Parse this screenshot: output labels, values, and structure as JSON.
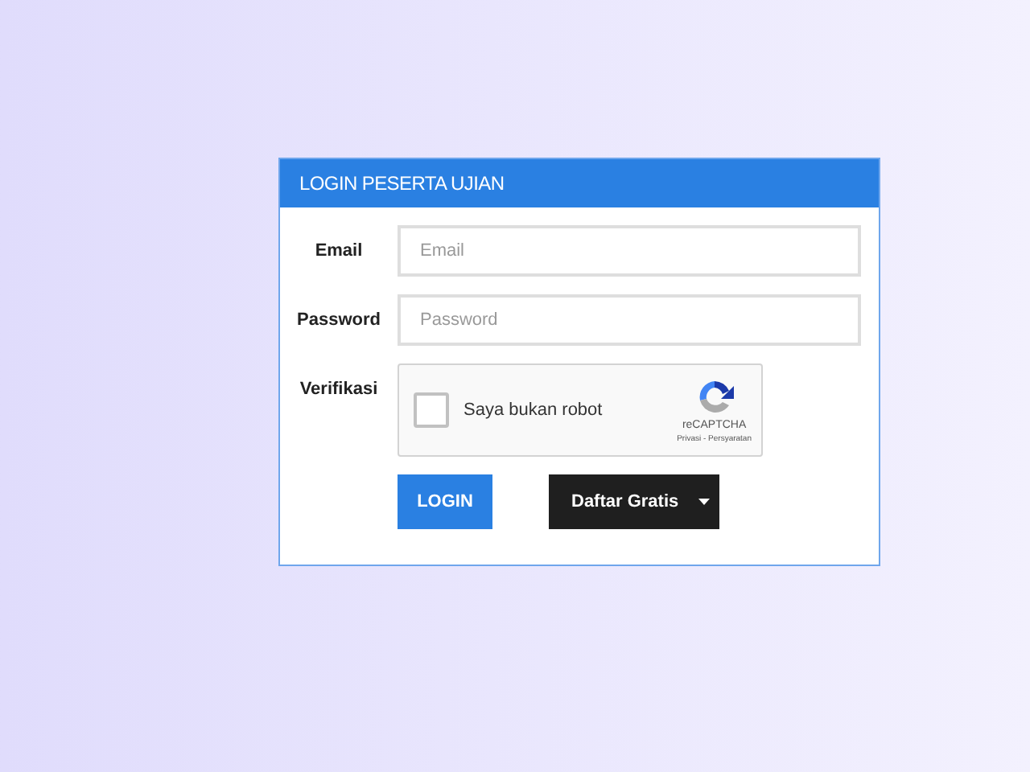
{
  "panel": {
    "title": "LOGIN PESERTA UJIAN"
  },
  "fields": [
    {
      "label": "Email",
      "placeholder": "Email"
    },
    {
      "label": "Password",
      "placeholder": "Password"
    }
  ],
  "verification": {
    "label": "Verifikasi",
    "captcha": {
      "checked": false,
      "text": "Saya bukan robot",
      "brand": "reCAPTCHA",
      "links": "Privasi - Persyaratan"
    }
  },
  "buttons": [
    {
      "label": "LOGIN",
      "kind": "primary"
    },
    {
      "label": "Daftar Gratis",
      "kind": "dropdown"
    }
  ]
}
